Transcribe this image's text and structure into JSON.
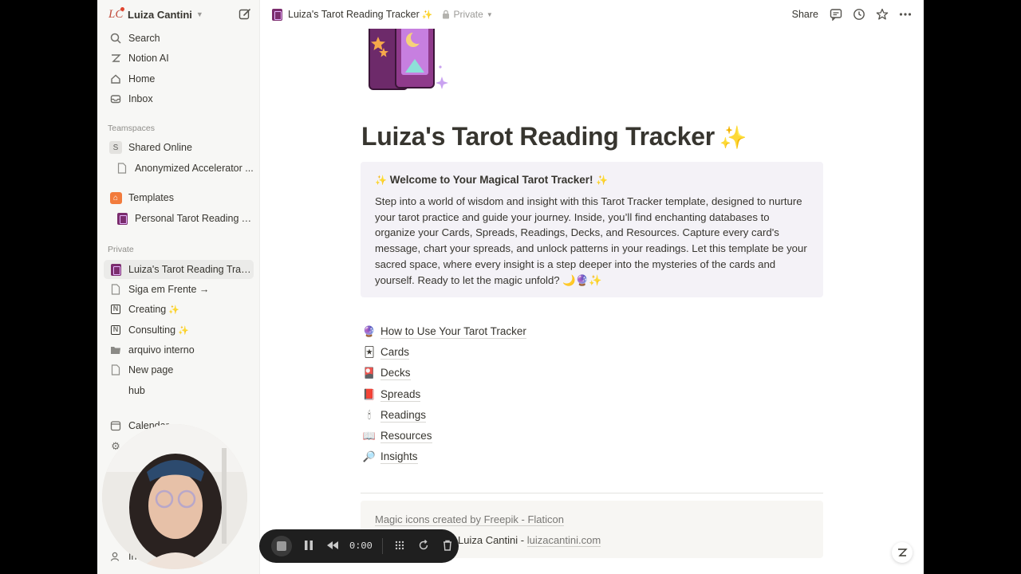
{
  "workspace": {
    "name": "Luiza Cantini",
    "logo_text": "LC"
  },
  "sidebar": {
    "top_items": [
      {
        "label": "Search",
        "icon": "search-icon"
      },
      {
        "label": "Notion AI",
        "icon": "notion-ai-icon"
      },
      {
        "label": "Home",
        "icon": "home-icon"
      },
      {
        "label": "Inbox",
        "icon": "inbox-icon"
      }
    ],
    "teamspaces_label": "Teamspaces",
    "shared_online": {
      "badge": "S",
      "label": "Shared Online"
    },
    "anonymized": "Anonymized Accelerator ...",
    "templates": "Templates",
    "personal_tarot": "Personal Tarot Reading T...",
    "private_label": "Private",
    "private_items": [
      {
        "label": "Luiza's Tarot Reading Trac...",
        "icon": "tarot-cards-icon",
        "active": true
      },
      {
        "label": "Siga em Frente →",
        "icon": "page-icon"
      },
      {
        "label": "Creating",
        "icon": "notion-icon",
        "sparkle": "✨"
      },
      {
        "label": "Consulting",
        "icon": "notion-icon",
        "sparkle": "✨"
      },
      {
        "label": "arquivo interno",
        "icon": "folder-icon"
      },
      {
        "label": "New page",
        "icon": "page-icon"
      },
      {
        "label": "hub",
        "icon": "blank-icon"
      }
    ],
    "calendar": "Calendar",
    "invite": "Invite"
  },
  "topbar": {
    "breadcrumb_title": "Luiza's Tarot Reading Tracker",
    "breadcrumb_sparkle": "✨",
    "privacy": "Private",
    "share": "Share"
  },
  "page": {
    "title": "Luiza's Tarot Reading Tracker",
    "title_sparkle": "✨",
    "callout": {
      "heading": "Welcome to Your Magical Tarot Tracker!",
      "sparkle": "✨",
      "body": "Step into a world of wisdom and insight with this Tarot Tracker template, designed to nurture your tarot practice and guide your journey. Inside, you’ll find enchanting databases to organize your Cards, Spreads, Readings, Decks, and Resources. Capture every card's message, chart your spreads, and unlock patterns in your readings. Let this template be your sacred space, where every insight is a step deeper into the mysteries of the cards and yourself. Ready to let the magic unfold? 🌙🔮✨"
    },
    "links": [
      {
        "label": "How to Use Your Tarot Tracker",
        "emoji": "🔮"
      },
      {
        "label": "Cards",
        "emoji": "🃏"
      },
      {
        "label": "Decks",
        "emoji": "🎴"
      },
      {
        "label": "Spreads",
        "emoji": "📕"
      },
      {
        "label": "Readings",
        "emoji": "🕯"
      },
      {
        "label": "Resources",
        "emoji": "📖"
      },
      {
        "label": "Insights",
        "emoji": "🔎"
      }
    ],
    "footer": {
      "credit": "Magic icons created by Freepik - Flaticon",
      "author": "Luiza Cantini",
      "separator": " - ",
      "site": "luizacantini.com"
    }
  },
  "recorder": {
    "time": "0:00"
  },
  "colors": {
    "accent_purple": "#7b2d6e",
    "callout_bg": "#f4f2f7",
    "sidebar_bg": "#f7f7f5"
  }
}
